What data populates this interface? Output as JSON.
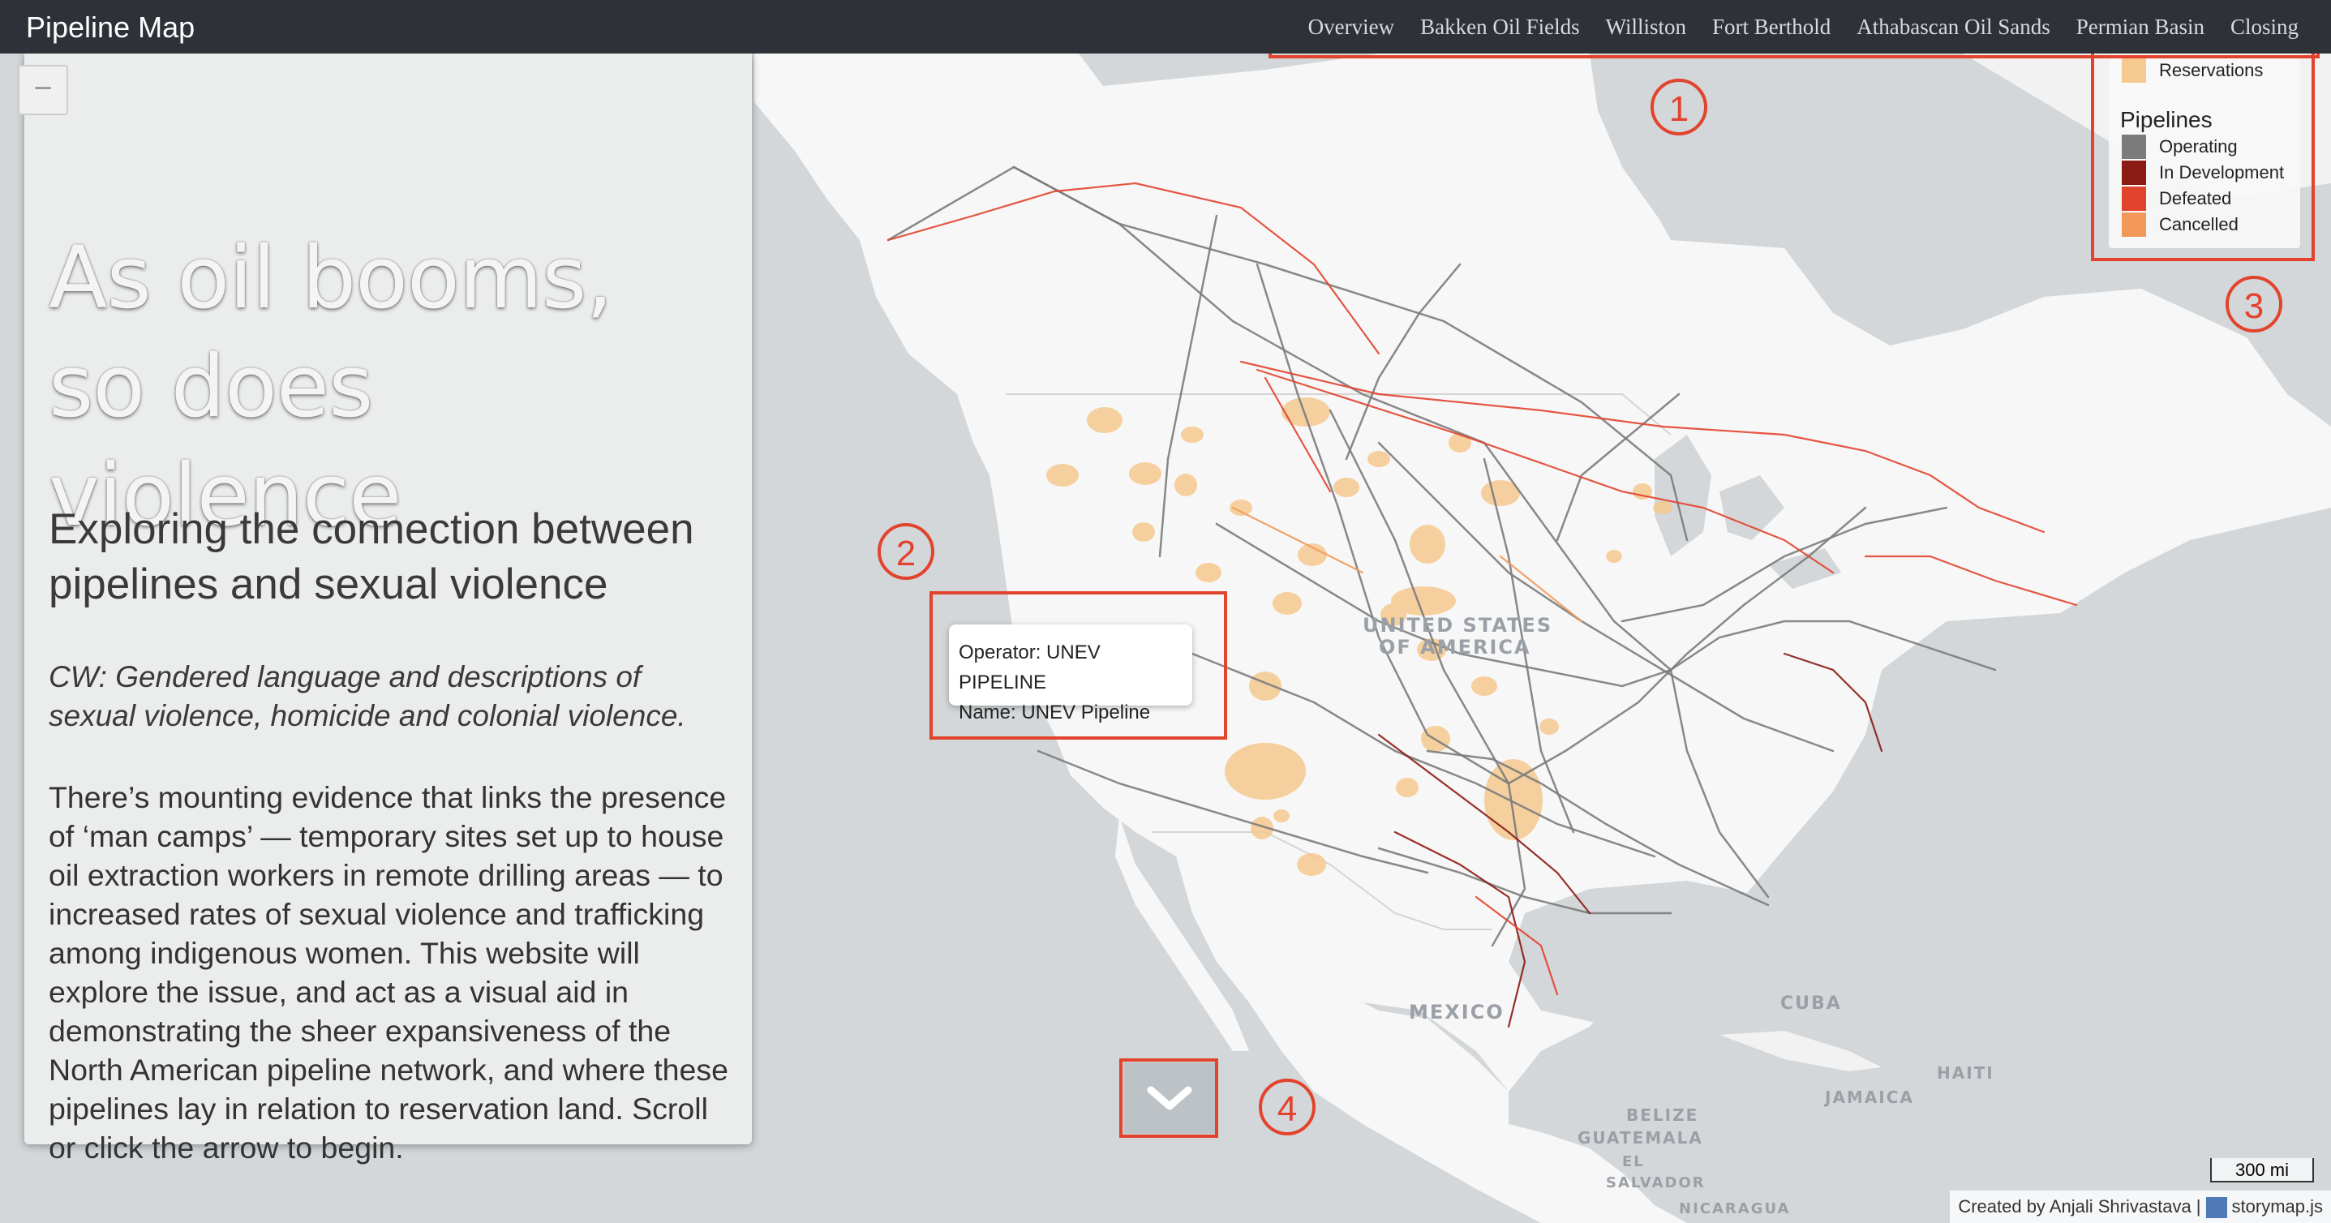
{
  "app": {
    "title": "Pipeline Map"
  },
  "nav": {
    "items": [
      "Overview",
      "Bakken Oil Fields",
      "Williston",
      "Fort Berthold",
      "Athabascan Oil Sands",
      "Permian Basin",
      "Closing"
    ]
  },
  "story": {
    "title": "As oil booms, so does violence",
    "subtitle": "Exploring the connection between pipelines and sexual violence",
    "content_warning": "CW: Gendered language and descriptions of sexual violence, homicide and colonial violence.",
    "body": "There’s mounting evidence that links the presence of ‘man camps’ — temporary sites set up to house oil extraction workers in remote drilling areas — to increased rates of sexual violence and trafficking among indigenous women. This website will explore the issue, and act as a visual aid in demonstrating the sheer expansiveness of the North American pipeline network, and where these pipelines lay in relation to reservation land. Scroll or click the arrow to begin."
  },
  "map_controls": {
    "zoom_out_symbol": "−"
  },
  "tooltip": {
    "operator": "Operator: UNEV PIPELINE",
    "name": "Name: UNEV Pipeline"
  },
  "legend": {
    "reservations_label": "Reservations",
    "reservations_color": "#f5c98f",
    "heading": "Pipelines",
    "items": [
      {
        "label": "Operating",
        "color": "#7b7b7b"
      },
      {
        "label": "In Development",
        "color": "#8b1a12"
      },
      {
        "label": "Defeated",
        "color": "#e2432d"
      },
      {
        "label": "Cancelled",
        "color": "#f2995a"
      }
    ]
  },
  "map_labels": {
    "usa_line1": "UNITED STATES",
    "usa_line2": "OF AMERICA",
    "mexico": "MEXICO",
    "cuba": "CUBA",
    "haiti": "HAITI",
    "jamaica": "JAMAICA",
    "belize": "BELIZE",
    "guatemala": "GUATEMALA",
    "el_salvador_line1": "EL",
    "el_salvador_line2": "SALVADOR",
    "nicaragua": "NICARAGUA"
  },
  "scale": "300 mi",
  "attribution": {
    "author": "Created by Anjali Shrivastava |",
    "tool": "storymap.js"
  },
  "annotations": [
    "1",
    "2",
    "3",
    "4"
  ],
  "colors": {
    "accent": "#e2432d",
    "topbar": "#2e3138",
    "land": "#f7f7f7",
    "water": "#d3d7d9"
  },
  "icons": {
    "scroll": "chevron-down-icon"
  }
}
